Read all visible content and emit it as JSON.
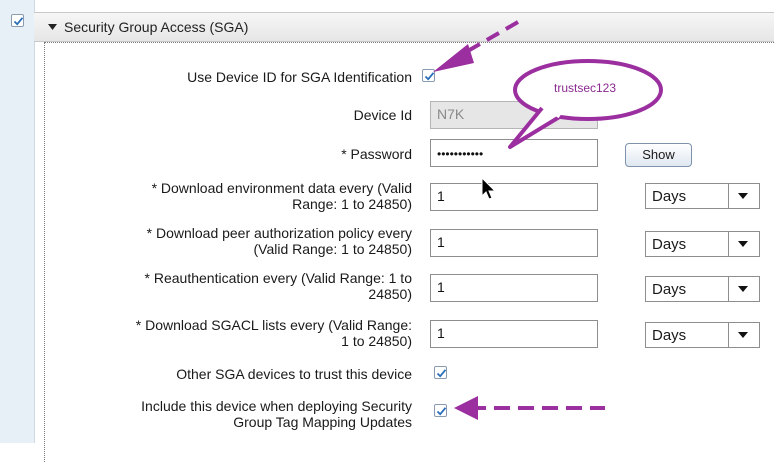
{
  "section": {
    "title": "Security Group Access (SGA)",
    "enabled_checked": true
  },
  "fields": {
    "use_device_id_label": "Use Device ID for SGA Identification",
    "use_device_id_checked": true,
    "device_id_label": "Device Id",
    "device_id_value": "N7K",
    "password_label": "* Password",
    "password_value": "•••••••••••",
    "show_button_label": "Show",
    "download_env_label_1": "* Download environment data every (Valid",
    "download_env_label_2": "Range: 1 to 24850)",
    "download_env_value": "1",
    "download_env_unit": "Days",
    "download_peer_label_1": "* Download peer authorization policy every",
    "download_peer_label_2": "(Valid Range: 1 to 24850)",
    "download_peer_value": "1",
    "download_peer_unit": "Days",
    "reauth_label_1": "* Reauthentication every (Valid Range: 1 to",
    "reauth_label_2": "24850)",
    "reauth_value": "1",
    "reauth_unit": "Days",
    "sgacl_label_1": "* Download SGACL lists every (Valid Range:",
    "sgacl_label_2": "1 to 24850)",
    "sgacl_value": "1",
    "sgacl_unit": "Days",
    "other_devices_label": "Other SGA devices to trust this device",
    "other_devices_checked": true,
    "include_device_label_1": "Include this device when deploying Security",
    "include_device_label_2": "Group Tag Mapping Updates",
    "include_device_checked": true
  },
  "annotation": {
    "bubble_text": "trustsec123",
    "color": "#9b2fa0"
  },
  "colors": {
    "check": "#2a6fb8",
    "panel_bg": "#e8f0f7"
  }
}
